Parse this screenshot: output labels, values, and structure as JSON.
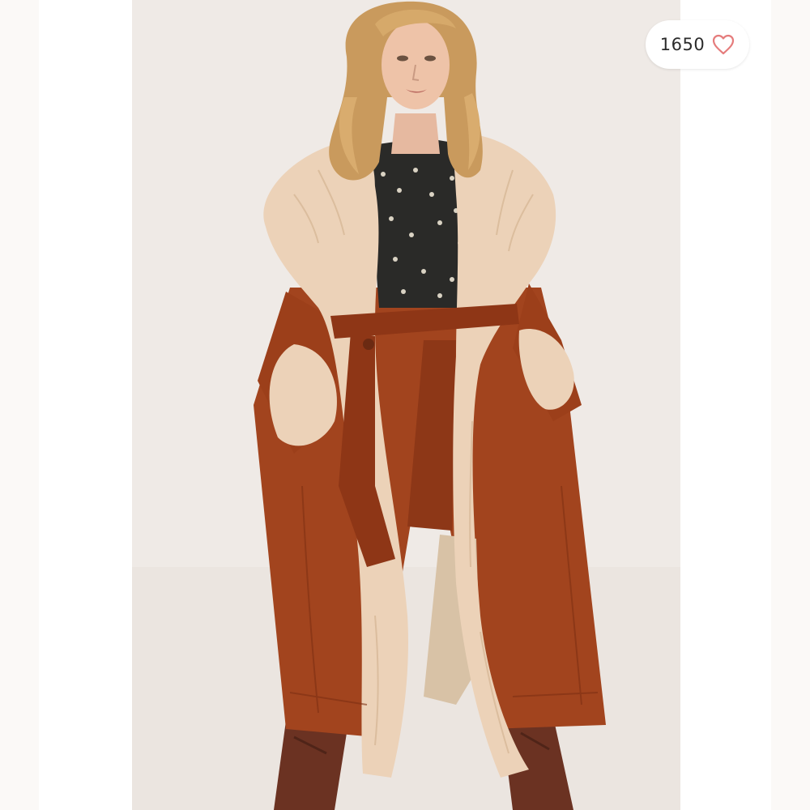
{
  "listing": {
    "like_count": "1650",
    "like_icon": "heart-outline-icon",
    "like_icon_color": "#e57c7c"
  },
  "photo": {
    "subject": "model-wearing-rust-suede-coat-with-cream-shaggy-faux-fur-trim",
    "background_color": "#efeae6",
    "coat_color": "#a2441e",
    "fur_color": "#ecd2b8"
  }
}
